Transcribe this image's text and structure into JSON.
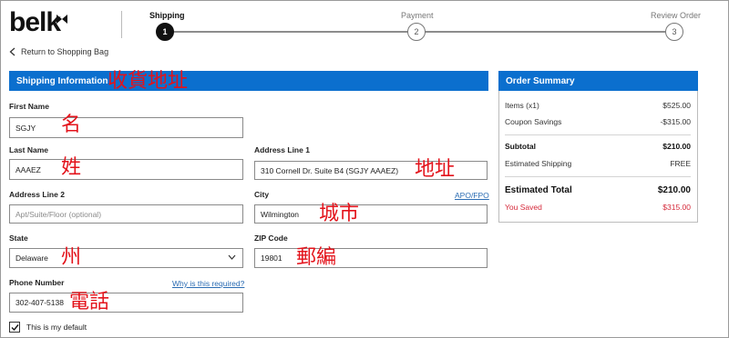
{
  "header": {
    "logo_text": "belk",
    "back_link": "Return to Shopping Bag"
  },
  "steps": [
    {
      "label": "Shipping",
      "number": "1",
      "active": true
    },
    {
      "label": "Payment",
      "number": "2",
      "active": false
    },
    {
      "label": "Review Order",
      "number": "3",
      "active": false
    }
  ],
  "shipping": {
    "title": "Shipping Information",
    "annotation": "收貨地址",
    "first_name": {
      "label": "First Name",
      "value": "SGJY",
      "annotation": "名"
    },
    "last_name": {
      "label": "Last Name",
      "value": "AAAEZ",
      "annotation": "姓"
    },
    "address1": {
      "label": "Address Line 1",
      "value": "310 Cornell Dr. Suite B4 (SGJY AAAEZ)",
      "annotation": "地址"
    },
    "address2": {
      "label": "Address Line 2",
      "placeholder": "Apt/Suite/Floor (optional)"
    },
    "city": {
      "label": "City",
      "value": "Wilmington",
      "link": "APO/FPO",
      "annotation": "城市"
    },
    "state": {
      "label": "State",
      "value": "Delaware",
      "annotation": "州"
    },
    "zip": {
      "label": "ZIP Code",
      "value": "19801",
      "annotation": "郵編"
    },
    "phone": {
      "label": "Phone Number",
      "value": "302-407-5138",
      "link": "Why is this required?",
      "annotation": "電話"
    },
    "default_checkbox": {
      "label": "This is my default",
      "checked": true
    }
  },
  "order_summary": {
    "title": "Order Summary",
    "items_label": "Items (x1)",
    "items_value": "$525.00",
    "coupon_label": "Coupon Savings",
    "coupon_value": "-$315.00",
    "subtotal_label": "Subtotal",
    "subtotal_value": "$210.00",
    "shipping_label": "Estimated Shipping",
    "shipping_value": "FREE",
    "total_label": "Estimated Total",
    "total_value": "$210.00",
    "saved_label": "You Saved",
    "saved_value": "$315.00"
  },
  "colors": {
    "accent": "#0b6fce",
    "annotation": "#e3131b",
    "saved": "#d5293a",
    "link": "#2b6cb3"
  },
  "icons": {
    "back": "chevron-left-icon",
    "select": "chevron-down-icon",
    "checkbox": "checkmark-icon"
  }
}
